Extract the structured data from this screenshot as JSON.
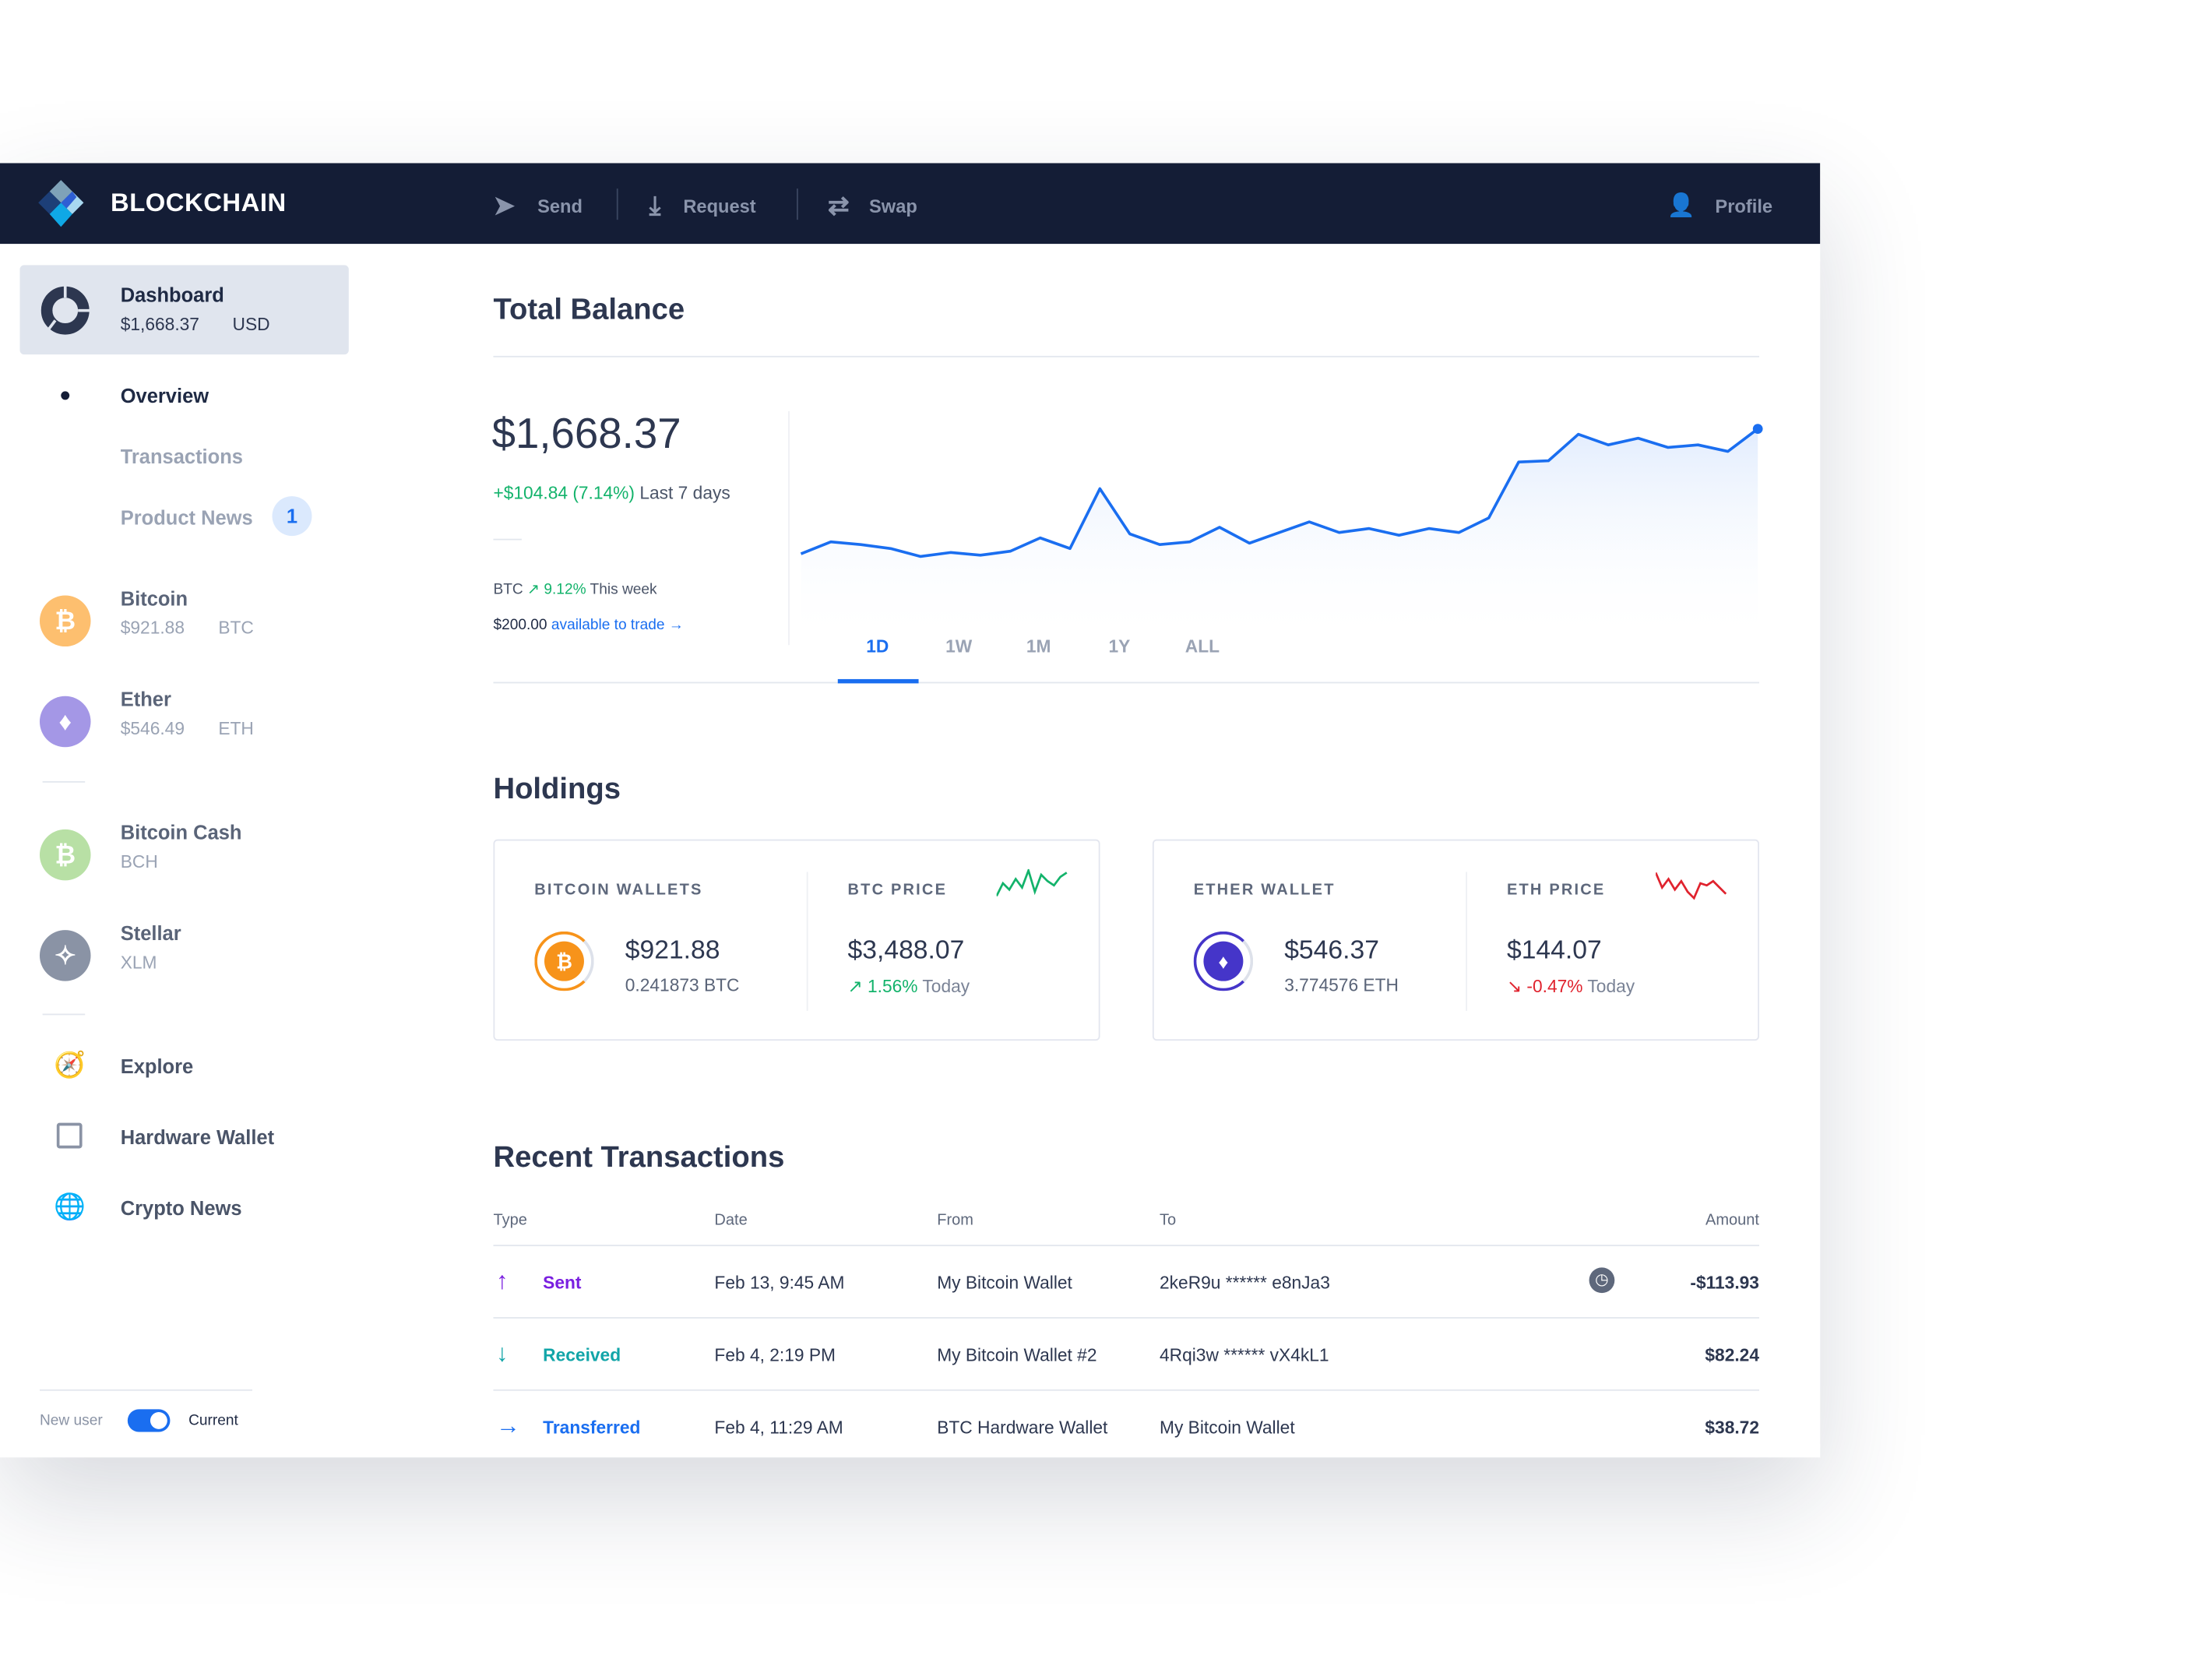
{
  "header": {
    "brand": "BLOCKCHAIN",
    "nav": [
      {
        "label": "Send",
        "icon": "paper-plane-icon"
      },
      {
        "label": "Request",
        "icon": "download-icon"
      },
      {
        "label": "Swap",
        "icon": "swap-arrows-icon"
      }
    ],
    "profile": "Profile"
  },
  "sidebar": {
    "dashboard": {
      "label": "Dashboard",
      "amount": "$1,668.37",
      "currency": "USD"
    },
    "subnav": [
      {
        "label": "Overview",
        "active": true
      },
      {
        "label": "Transactions"
      },
      {
        "label": "Product News",
        "badge": "1"
      }
    ],
    "coins": [
      {
        "name": "Bitcoin",
        "amount": "$921.88",
        "ticker": "BTC",
        "color": "#fdbf6f",
        "glyph": "₿"
      },
      {
        "name": "Ether",
        "amount": "$546.49",
        "ticker": "ETH",
        "color": "#a497e6",
        "glyph": "♦"
      },
      {
        "name": "Bitcoin Cash",
        "amount": "",
        "ticker": "BCH",
        "color": "#b8e0a5",
        "glyph": "₿"
      },
      {
        "name": "Stellar",
        "amount": "",
        "ticker": "XLM",
        "color": "#8a93a5",
        "glyph": "✧"
      }
    ],
    "links": [
      {
        "label": "Explore",
        "icon": "compass-icon"
      },
      {
        "label": "Hardware Wallet",
        "icon": "hardware-wallet-icon"
      },
      {
        "label": "Crypto News",
        "icon": "globe-icon"
      }
    ],
    "toggle": {
      "left": "New user",
      "right": "Current",
      "on": true
    }
  },
  "balance": {
    "title": "Total Balance",
    "amount": "$1,668.37",
    "change": "+$104.84 (7.14%)",
    "change_period": "Last 7 days",
    "btc_label": "BTC",
    "btc_change": "9.12%",
    "btc_period": "This week",
    "trade_amount": "$200.00",
    "trade_link": "available to trade →",
    "tabs": [
      "1D",
      "1W",
      "1M",
      "1Y",
      "ALL"
    ],
    "active_tab": "1D"
  },
  "chart_data": {
    "type": "area",
    "color": "#1a6ef0",
    "values": [
      58,
      67,
      65,
      62,
      56,
      59,
      57,
      60,
      70,
      62,
      107,
      73,
      65,
      67,
      78,
      66,
      74,
      82,
      74,
      77,
      72,
      77,
      74,
      85,
      127,
      128,
      148,
      140,
      145,
      138,
      140,
      135,
      152
    ]
  },
  "holdings": {
    "title": "Holdings",
    "cards": [
      {
        "wallet_label": "BITCOIN WALLETS",
        "balance": "$921.88",
        "units": "0.241873 BTC",
        "price_label": "BTC PRICE",
        "price": "$3,488.07",
        "change": "1.56%",
        "arrow": "↗",
        "period": "Today",
        "trend": "up",
        "coin_color": "#f7931a",
        "glyph": "₿",
        "spark": [
          2,
          8,
          5,
          10,
          6,
          14,
          4,
          12,
          9,
          7,
          11,
          13
        ]
      },
      {
        "wallet_label": "ETHER WALLET",
        "balance": "$546.37",
        "units": "3.774576 ETH",
        "price_label": "ETH PRICE",
        "price": "$144.07",
        "change": "-0.47%",
        "arrow": "↘",
        "period": "Today",
        "trend": "down",
        "coin_color": "#4535c9",
        "glyph": "♦",
        "spark": [
          13,
          6,
          10,
          5,
          9,
          4,
          1,
          8,
          7,
          9,
          6,
          3
        ]
      }
    ]
  },
  "transactions": {
    "title": "Recent Transactions",
    "columns": [
      "Type",
      "Date",
      "From",
      "To",
      "Amount"
    ],
    "rows": [
      {
        "type": "Sent",
        "arrow": "↑",
        "color": "#7a1fe0",
        "date": "Feb 13, 9:45 AM",
        "from": "My Bitcoin Wallet",
        "to": "2keR9u ****** e8nJa3",
        "amount": "-$113.93",
        "pending": true
      },
      {
        "type": "Received",
        "arrow": "↓",
        "color": "#12a5a8",
        "date": "Feb 4, 2:19 PM",
        "from": "My Bitcoin Wallet #2",
        "to": "4Rqi3w ****** vX4kL1",
        "amount": "$82.24"
      },
      {
        "type": "Transferred",
        "arrow": "→",
        "color": "#1a6ef0",
        "date": "Feb 4, 11:29 AM",
        "from": "BTC Hardware Wallet",
        "to": "My Bitcoin Wallet",
        "amount": "$38.72"
      }
    ]
  }
}
